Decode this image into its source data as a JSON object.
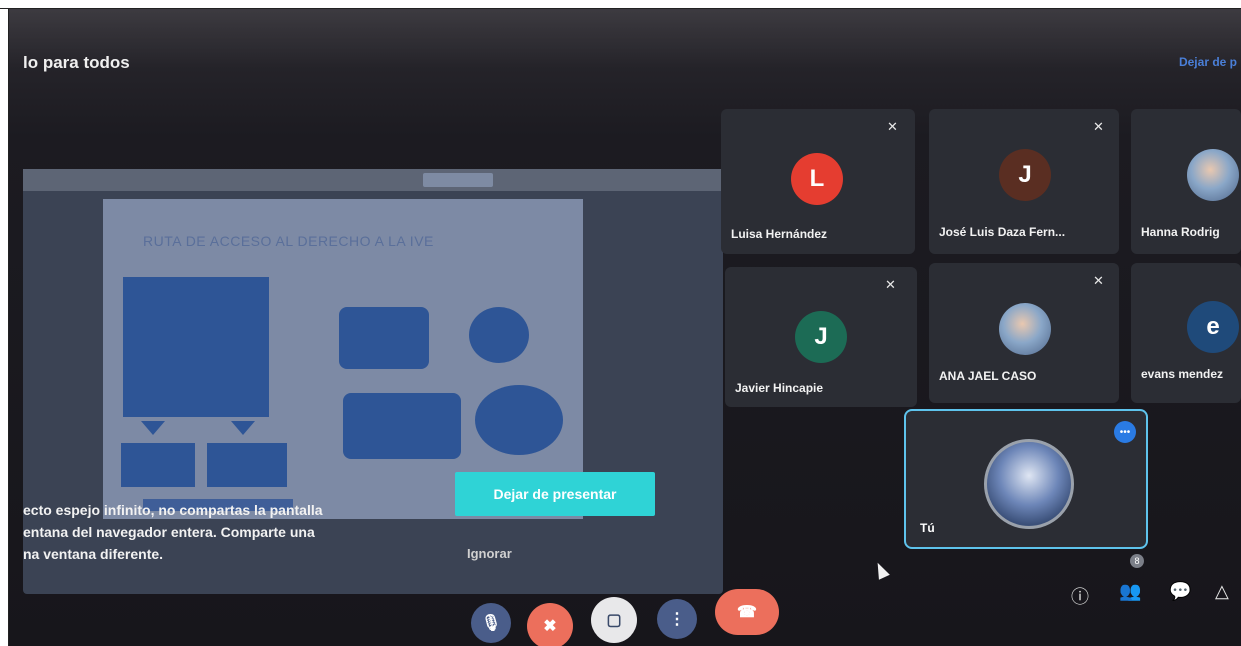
{
  "header": {
    "title": "lo para todos",
    "right_link": "Dejar de p"
  },
  "presentation": {
    "slide_title": "RUTA DE ACCESO AL DERECHO A LA IVE"
  },
  "warning": {
    "lines": [
      "ecto espejo infinito, no compartas la pantalla",
      "entana del navegador entera. Comparte una",
      "na ventana diferente."
    ],
    "stop_button": "Dejar de presentar",
    "ignore": "Ignorar"
  },
  "participants": [
    {
      "initial": "L",
      "name": "Luisa Hernández",
      "color": "#e53d30"
    },
    {
      "initial": "J",
      "name": "José Luis Daza Fern...",
      "color": "#5a2e22"
    },
    {
      "initial": "",
      "name": "Hanna Rodrig",
      "color": "#3a3a3a"
    },
    {
      "initial": "J",
      "name": "Javier Hincapie",
      "color": "#1c6b55"
    },
    {
      "initial": "",
      "name": "ANA JAEL CASO",
      "color": "#6b85ad"
    },
    {
      "initial": "e",
      "name": "evans mendez",
      "color": "#1f4a7a"
    }
  ],
  "self": {
    "name": "Tú",
    "more_icon": "•••"
  },
  "controls": {
    "mic_icon": "🎙",
    "camera_icon": "✖",
    "present_icon": "▢",
    "more_icon": "⋮",
    "hangup_icon": "☎",
    "info_icon": "ⓘ",
    "people_icon": "👥",
    "people_count": "8",
    "chat_icon": "💬",
    "activities_icon": "△"
  },
  "colors": {
    "accent_cyan": "#2fd3d6",
    "hangup_red": "#ec6f5c",
    "link_blue": "#4a7fd8"
  }
}
